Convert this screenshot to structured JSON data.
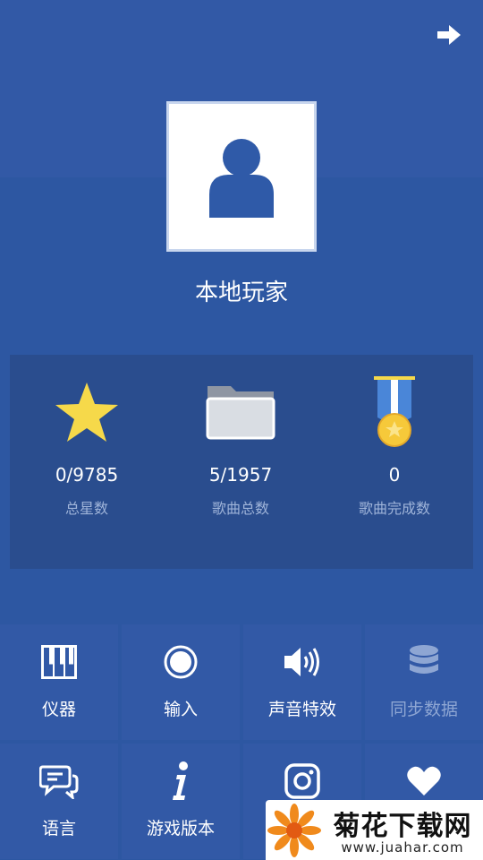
{
  "profile": {
    "player_name": "本地玩家"
  },
  "stats": [
    {
      "value": "0/9785",
      "label": "总星数",
      "icon": "star-icon"
    },
    {
      "value": "5/1957",
      "label": "歌曲总数",
      "icon": "folder-icon"
    },
    {
      "value": "0",
      "label": "歌曲完成数",
      "icon": "medal-icon"
    }
  ],
  "menu": [
    {
      "label": "仪器",
      "icon": "piano-keys-icon",
      "enabled": true
    },
    {
      "label": "输入",
      "icon": "record-circle-icon",
      "enabled": true
    },
    {
      "label": "声音特效",
      "icon": "speaker-icon",
      "enabled": true
    },
    {
      "label": "同步数据",
      "icon": "database-icon",
      "enabled": false
    },
    {
      "label": "语言",
      "icon": "chat-bubble-icon",
      "enabled": true
    },
    {
      "label": "游戏版本",
      "icon": "info-icon",
      "enabled": true
    },
    {
      "label": "",
      "icon": "instagram-icon",
      "enabled": true
    },
    {
      "label": "",
      "icon": "heart-icon",
      "enabled": true
    }
  ],
  "watermark": {
    "title": "菊花下载网",
    "url": "www.juahar.com"
  },
  "colors": {
    "background": "#2d57a2",
    "panel": "#2a4d8e",
    "tile": "#3259a6",
    "star": "#f6d94a",
    "muted_label": "#9fb4d9"
  }
}
